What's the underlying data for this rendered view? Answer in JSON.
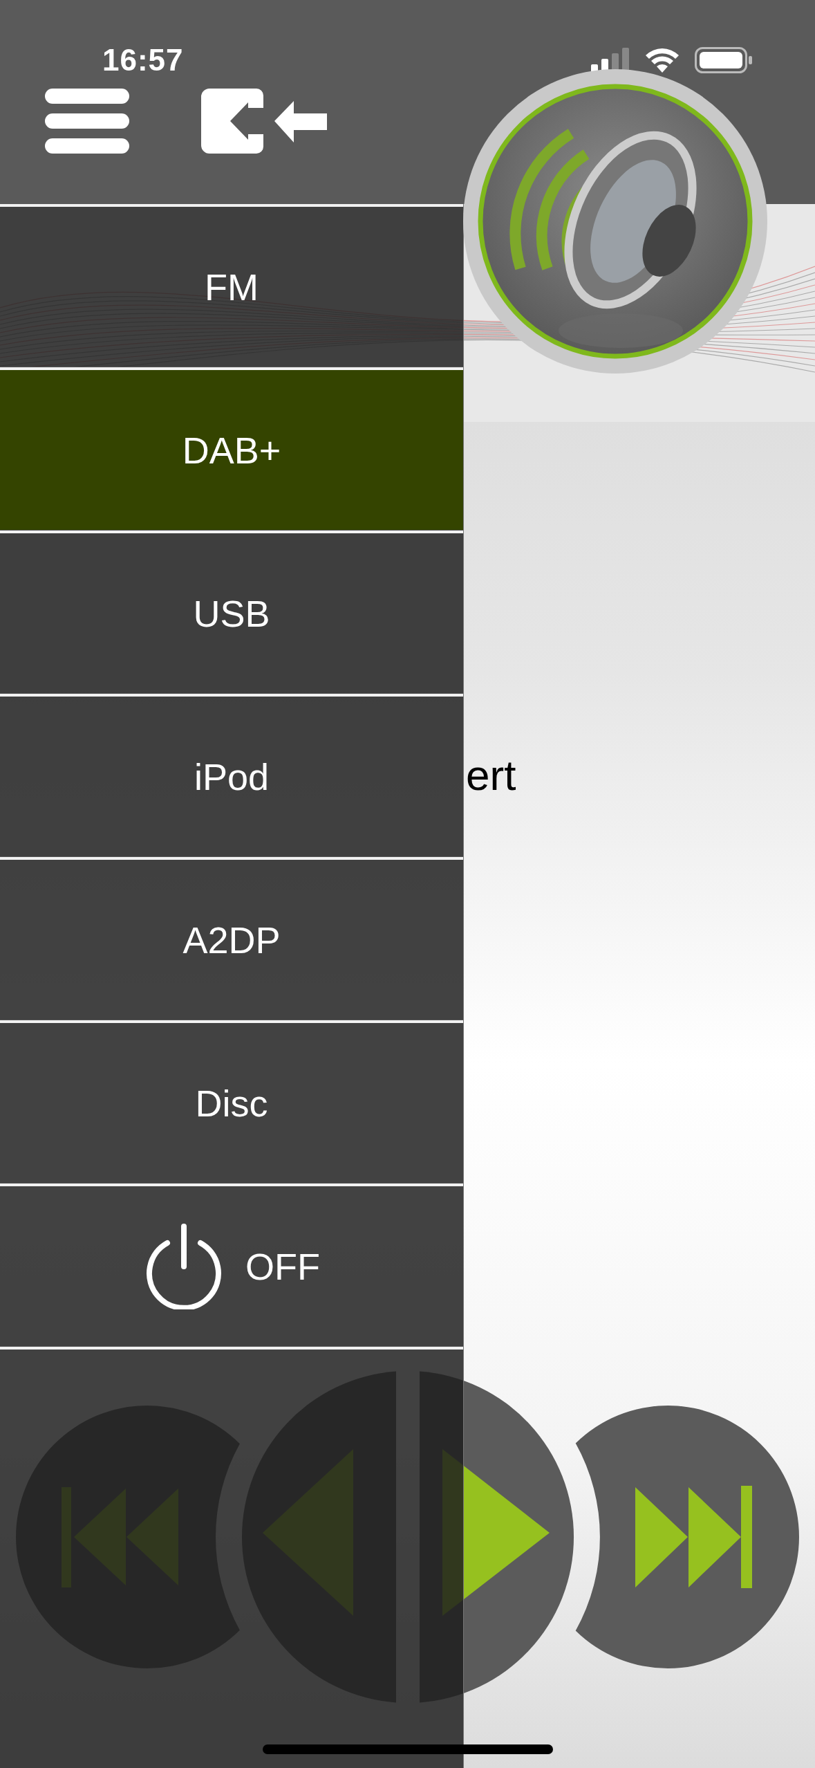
{
  "status_bar": {
    "time": "16:57"
  },
  "station": {
    "slogan": "ert"
  },
  "menu": {
    "items": [
      {
        "label": "FM",
        "kind": "text",
        "selected": false
      },
      {
        "label": "DAB+",
        "kind": "text",
        "selected": true
      },
      {
        "label": "USB",
        "kind": "text",
        "selected": false
      },
      {
        "label": "iPod",
        "kind": "text",
        "selected": false
      },
      {
        "label": "A2DP",
        "kind": "text",
        "selected": false
      },
      {
        "label": "Disc",
        "kind": "text",
        "selected": false
      },
      {
        "label": "OFF",
        "kind": "power",
        "selected": false
      }
    ]
  }
}
